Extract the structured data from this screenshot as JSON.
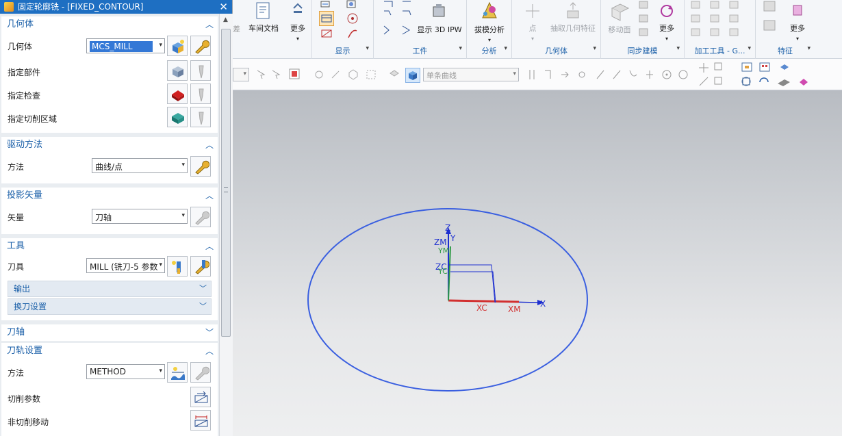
{
  "dialog": {
    "title": "固定轮廓铣 - [FIXED_CONTOUR]",
    "close": "✕",
    "sections": {
      "geometry": {
        "title": "几何体",
        "geometry_label": "几何体",
        "geometry_value": "MCS_MILL",
        "part_label": "指定部件",
        "check_label": "指定检查",
        "cut_area_label": "指定切削区域"
      },
      "drive": {
        "title": "驱动方法",
        "method_label": "方法",
        "method_value": "曲线/点"
      },
      "projection": {
        "title": "投影矢量",
        "vector_label": "矢量",
        "vector_value": "刀轴"
      },
      "tool": {
        "title": "工具",
        "tool_label": "刀具",
        "tool_value": "MILL (铣刀-5 参数",
        "output_label": "输出",
        "tool_change_label": "换刀设置"
      },
      "tool_axis": {
        "title": "刀轴"
      },
      "path_settings": {
        "title": "刀轨设置",
        "method_label": "方法",
        "method_value": "METHOD",
        "cut_params_label": "切削参数",
        "non_cut_label": "非切削移动"
      }
    }
  },
  "ribbon": {
    "groups": {
      "display": "显示",
      "workpiece": "工件",
      "analysis": "分析",
      "geometry": "几何体",
      "sync": "同步建模",
      "machining_tools": "加工工具 - G...",
      "feature": "特征"
    },
    "buttons": {
      "workshop_doc": "车间文档",
      "more1": "更多",
      "show_3d_ipw": "显示 3D IPW",
      "draft_analysis": "拔模分析",
      "point": "点",
      "extract_geom": "抽取几何特征",
      "move_face": "移动面",
      "more2": "更多",
      "more3": "更多"
    },
    "partial_left": "差"
  },
  "toolbar2": {
    "curve_rule": "单条曲线"
  },
  "viewport": {
    "axis_labels": {
      "z": "Z",
      "zm": "ZM",
      "y": "Y",
      "ym": "YM",
      "zc": "ZC",
      "yc": "YC",
      "x": "X",
      "xc": "XC",
      "xm": "XM"
    }
  },
  "colors": {
    "accent": "#1a5fa8",
    "title_bar": "#1e6fc2",
    "circle": "#3a5fe0",
    "axis_red": "#d23030",
    "axis_blue": "#1d2fd0",
    "axis_green": "#2e9a45"
  }
}
